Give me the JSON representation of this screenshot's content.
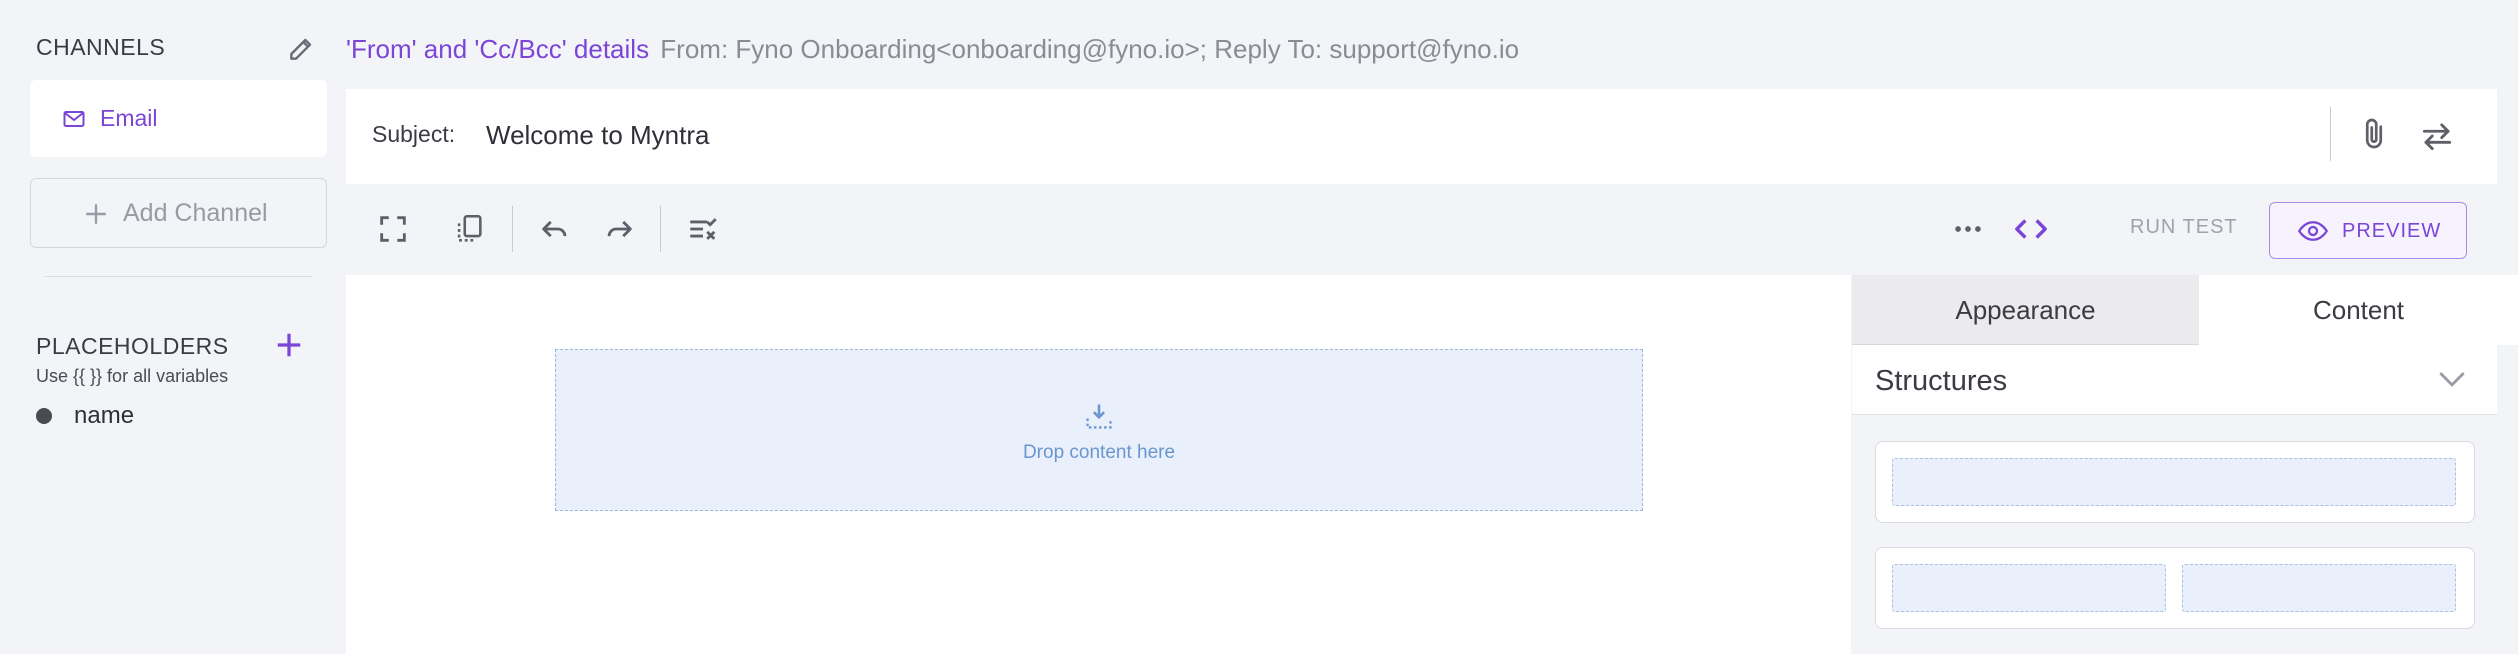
{
  "sidebar": {
    "channels_title": "CHANNELS",
    "channels": [
      {
        "label": "Email",
        "icon": "mail-icon"
      }
    ],
    "add_channel_label": "Add Channel",
    "placeholders_title": "PLACEHOLDERS",
    "placeholders_hint": "Use {{ }} for all variables",
    "placeholders": [
      {
        "name": "name"
      }
    ]
  },
  "details": {
    "link_label": "'From' and 'Cc/Bcc' details",
    "summary": "From: Fyno Onboarding<onboarding@fyno.io>; Reply To: support@fyno.io"
  },
  "subject": {
    "label": "Subject:",
    "value": "Welcome to Myntra"
  },
  "toolbar": {
    "run_test_label": "RUN TEST",
    "preview_label": "PREVIEW",
    "icons": [
      "fullscreen-icon",
      "mobile-view-icon",
      "undo-icon",
      "redo-icon",
      "clear-icon",
      "more-icon",
      "code-icon"
    ]
  },
  "canvas": {
    "drop_label": "Drop content here"
  },
  "panel": {
    "tabs": [
      {
        "label": "Appearance"
      },
      {
        "label": "Content"
      }
    ],
    "active_tab": "Content",
    "structures_label": "Structures"
  },
  "colors": {
    "accent": "#7b45d6",
    "background": "#f3f4f8",
    "drop_zone": "#e9f0fb"
  }
}
